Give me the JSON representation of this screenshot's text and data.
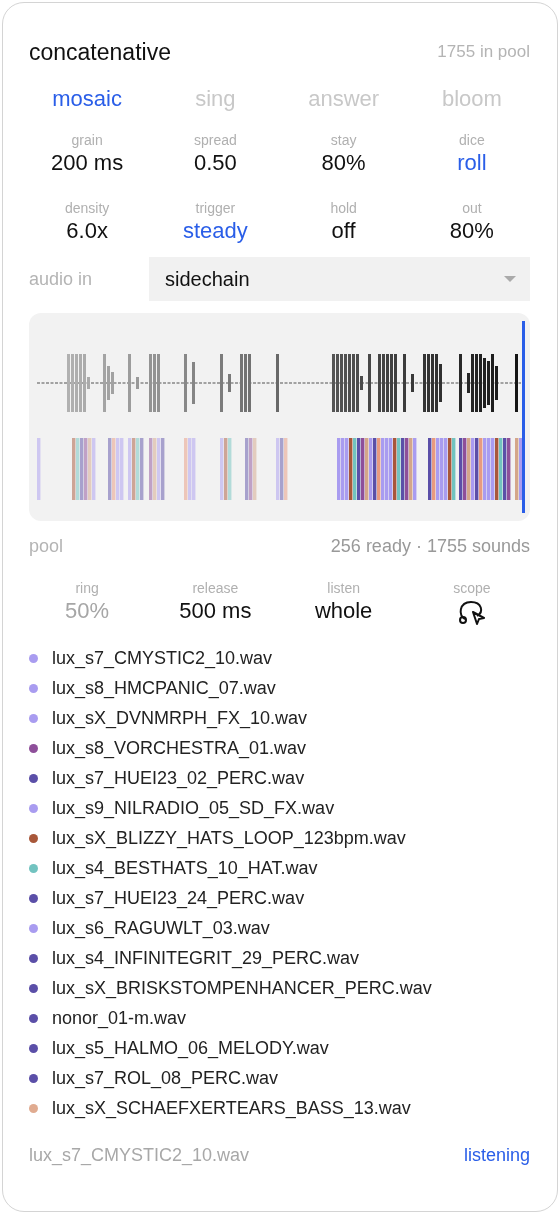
{
  "header": {
    "title": "concatenative",
    "pool_count": "1755 in pool"
  },
  "tabs": [
    {
      "label": "mosaic",
      "selected": true
    },
    {
      "label": "sing",
      "selected": false
    },
    {
      "label": "answer",
      "selected": false
    },
    {
      "label": "bloom",
      "selected": false
    }
  ],
  "params": [
    {
      "label": "grain",
      "value": "200 ms",
      "kind": "value"
    },
    {
      "label": "spread",
      "value": "0.50",
      "kind": "value"
    },
    {
      "label": "stay",
      "value": "80%",
      "kind": "value"
    },
    {
      "label": "dice",
      "value": "roll",
      "kind": "choice"
    },
    {
      "label": "density",
      "value": "6.0x",
      "kind": "value"
    },
    {
      "label": "trigger",
      "value": "steady",
      "kind": "choice"
    },
    {
      "label": "hold",
      "value": "off",
      "kind": "value"
    },
    {
      "label": "out",
      "value": "80%",
      "kind": "value"
    }
  ],
  "audio_in": {
    "label": "audio in",
    "value": "sidechain"
  },
  "pool": {
    "label": "pool",
    "status": "256 ready · 1755 sounds"
  },
  "pool_params": [
    {
      "label": "ring",
      "value": "50%",
      "kind": "value",
      "disabled": true
    },
    {
      "label": "release",
      "value": "500 ms",
      "kind": "value",
      "disabled": false
    },
    {
      "label": "listen",
      "value": "whole",
      "kind": "value",
      "disabled": false
    },
    {
      "label": "scope",
      "kind": "icon",
      "disabled": false
    }
  ],
  "files": [
    {
      "name": "lux_s7_CMYSTIC2_10.wav",
      "color": "#a99cf0"
    },
    {
      "name": "lux_s8_HMCPANIC_07.wav",
      "color": "#a99cf0"
    },
    {
      "name": "lux_sX_DVNMRPH_FX_10.wav",
      "color": "#a99cf0"
    },
    {
      "name": "lux_s8_VORCHESTRA_01.wav",
      "color": "#8e4f9a"
    },
    {
      "name": "lux_s7_HUEI23_02_PERC.wav",
      "color": "#5b4fa8"
    },
    {
      "name": "lux_s9_NILRADIO_05_SD_FX.wav",
      "color": "#a99cf0"
    },
    {
      "name": "lux_sX_BLIZZY_HATS_LOOP_123bpm.wav",
      "color": "#a8573a"
    },
    {
      "name": "lux_s4_BESTHATS_10_HAT.wav",
      "color": "#72c3c0"
    },
    {
      "name": "lux_s7_HUEI23_24_PERC.wav",
      "color": "#5b4fa8"
    },
    {
      "name": "lux_s6_RAGUWLT_03.wav",
      "color": "#a99cf0"
    },
    {
      "name": "lux_s4_INFINITEGRIT_29_PERC.wav",
      "color": "#5b4fa8"
    },
    {
      "name": "lux_sX_BRISKSTOMPENHANCER_PERC.wav",
      "color": "#5b4fa8"
    },
    {
      "name": "nonor_01-m.wav",
      "color": "#5b4fa8"
    },
    {
      "name": "lux_s5_HALMO_06_MELODY.wav",
      "color": "#5b4fa8"
    },
    {
      "name": "lux_s7_ROL_08_PERC.wav",
      "color": "#5b4fa8"
    },
    {
      "name": "lux_sX_SCHAEFXERTEARS_BASS_13.wav",
      "color": "#e0ab90"
    }
  ],
  "footer": {
    "current": "lux_s7_CMYSTIC2_10.wav",
    "status": "listening"
  }
}
